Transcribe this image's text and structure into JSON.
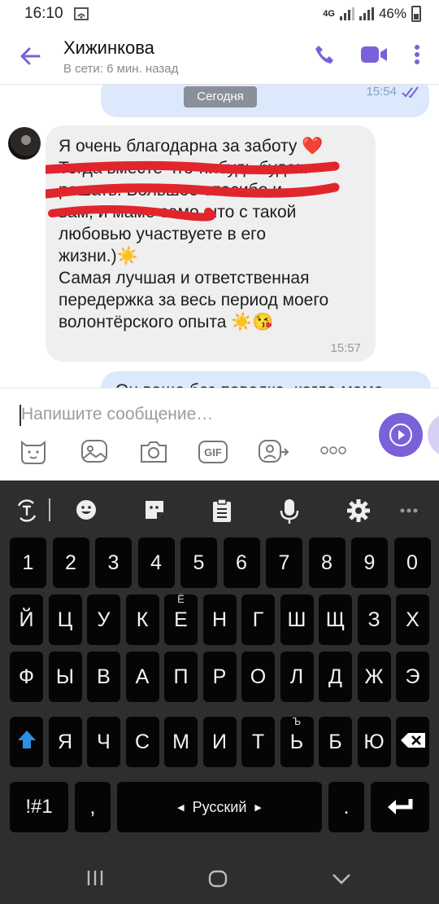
{
  "status_bar": {
    "time": "16:10",
    "network": "4G",
    "battery": "46%"
  },
  "header": {
    "contact_name": "Хижинкова",
    "last_seen": "В сети: 6 мин. назад"
  },
  "chat": {
    "date_divider": "Сегодня",
    "outgoing_top": {
      "time": "15:54"
    },
    "incoming": {
      "text": "Я очень благодарна за заботу ❤️\nТогда вместе что-нибудь будем\nрешать. Большое спасибо и\nвам, и маме само, что с такой\nлюбовью  участвуете в его\nжизни.)☀️\nСамая лучшая и ответственная\nпередержка за весь период моего\nволонтёрского опыта ☀️😘",
      "time": "15:57"
    },
    "outgoing_bottom": {
      "text": "Он ваще без поводка, когда мама"
    }
  },
  "composer": {
    "placeholder": "Напишите сообщение…",
    "icons": [
      "sticker-icon",
      "image-icon",
      "camera-icon",
      "gif-icon",
      "share-contact-icon",
      "more-icon"
    ],
    "gif_label": "GIF"
  },
  "keyboard": {
    "toolbar": [
      "translate-icon",
      "emoji-icon",
      "sticker-icon",
      "clipboard-icon",
      "mic-icon",
      "settings-icon",
      "more-icon"
    ],
    "row_numbers": [
      "1",
      "2",
      "3",
      "4",
      "5",
      "6",
      "7",
      "8",
      "9",
      "0"
    ],
    "row_1": [
      "Й",
      "Ц",
      "У",
      "К",
      "Е",
      "Н",
      "Г",
      "Ш",
      "Щ",
      "З",
      "Х"
    ],
    "row_2": [
      "Ф",
      "Ы",
      "В",
      "А",
      "П",
      "Р",
      "О",
      "Л",
      "Д",
      "Ж",
      "Э"
    ],
    "row_3": [
      "Я",
      "Ч",
      "С",
      "М",
      "И",
      "Т",
      "Ь",
      "Б",
      "Ю"
    ],
    "hint_e": "Ё",
    "hint_soft": "Ъ",
    "symbols_label": "!#1",
    "comma_label": ",",
    "space_label": "Русский",
    "period_label": "."
  },
  "colors": {
    "accent": "#7b61d8",
    "outgoing_bubble": "#dce8fb",
    "incoming_bubble": "#efefef",
    "keyboard_bg": "#2e2e2e",
    "key_bg": "#050505"
  }
}
